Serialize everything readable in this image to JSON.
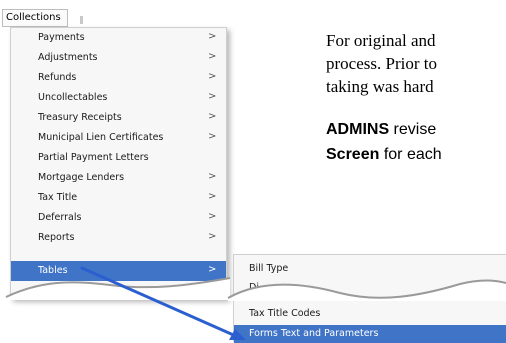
{
  "menubar": {
    "collections_label": "Collections"
  },
  "menu": {
    "items": [
      {
        "label": "Payments",
        "arrow": ">"
      },
      {
        "label": "Adjustments",
        "arrow": ">"
      },
      {
        "label": "Refunds",
        "arrow": ">"
      },
      {
        "label": "Uncollectables",
        "arrow": ">"
      },
      {
        "label": "Treasury Receipts",
        "arrow": ">"
      },
      {
        "label": "Municipal Lien Certificates",
        "arrow": ">"
      },
      {
        "label": "Partial Payment Letters",
        "arrow": ""
      },
      {
        "label": "Mortgage Lenders",
        "arrow": ">"
      },
      {
        "label": "Tax Title",
        "arrow": ">"
      },
      {
        "label": "Deferrals",
        "arrow": ">"
      },
      {
        "label": "Reports",
        "arrow": ">"
      },
      {
        "label": "Tables",
        "arrow": ">",
        "selected": true
      },
      {
        "label": "",
        "arrow": ">"
      }
    ]
  },
  "submenu": {
    "top_items": [
      {
        "label": "Bill Type"
      },
      {
        "label": "Di"
      }
    ],
    "bottom_items": [
      {
        "label": "Tax Title Codes"
      },
      {
        "label": "Forms Text and Parameters",
        "selected": true
      }
    ]
  },
  "document": {
    "line1": "For original and",
    "line2": "process.  Prior to",
    "line3": "taking was hard",
    "line4_bold": "ADMINS",
    "line4_rest": " revise",
    "line5_bold": "Screen",
    "line5_rest": " for each"
  },
  "colors": {
    "selection": "#3f74c7",
    "arrow": "#2b5fd0"
  }
}
